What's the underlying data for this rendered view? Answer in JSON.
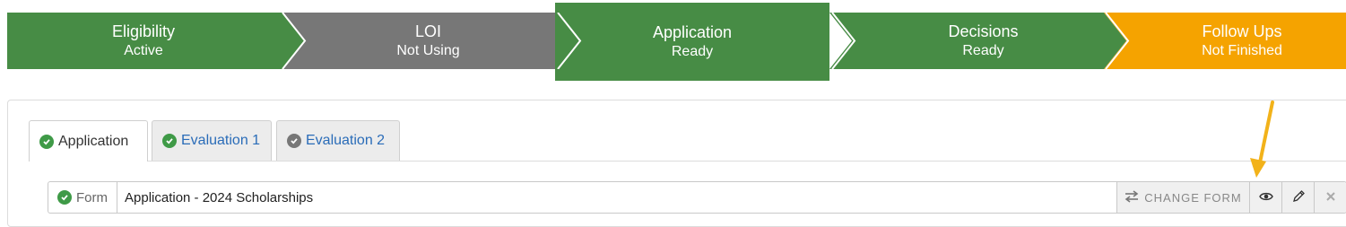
{
  "stages": [
    {
      "title": "Eligibility",
      "status": "Active"
    },
    {
      "title": "LOI",
      "status": "Not Using"
    },
    {
      "title": "Application",
      "status": "Ready"
    },
    {
      "title": "Decisions",
      "status": "Ready"
    },
    {
      "title": "Follow Ups",
      "status": "Not Finished"
    }
  ],
  "tabs": [
    {
      "label": "Application",
      "active": true,
      "icon": "check-circle-icon"
    },
    {
      "label": "Evaluation 1",
      "active": false,
      "icon": "check-circle-icon"
    },
    {
      "label": "Evaluation 2",
      "active": false,
      "icon": "check-circle-icon"
    }
  ],
  "form": {
    "addon_label": "Form",
    "name": "Application - 2024 Scholarships",
    "change_label": "CHANGE FORM",
    "icons": [
      "exchange-icon",
      "eye-icon",
      "pencil-icon",
      "close-icon"
    ]
  },
  "colors": {
    "green": "#478c45",
    "grey": "#777777",
    "orange": "#f5a300",
    "link": "#2a6cb8",
    "annotation_arrow": "#f2b21a"
  }
}
